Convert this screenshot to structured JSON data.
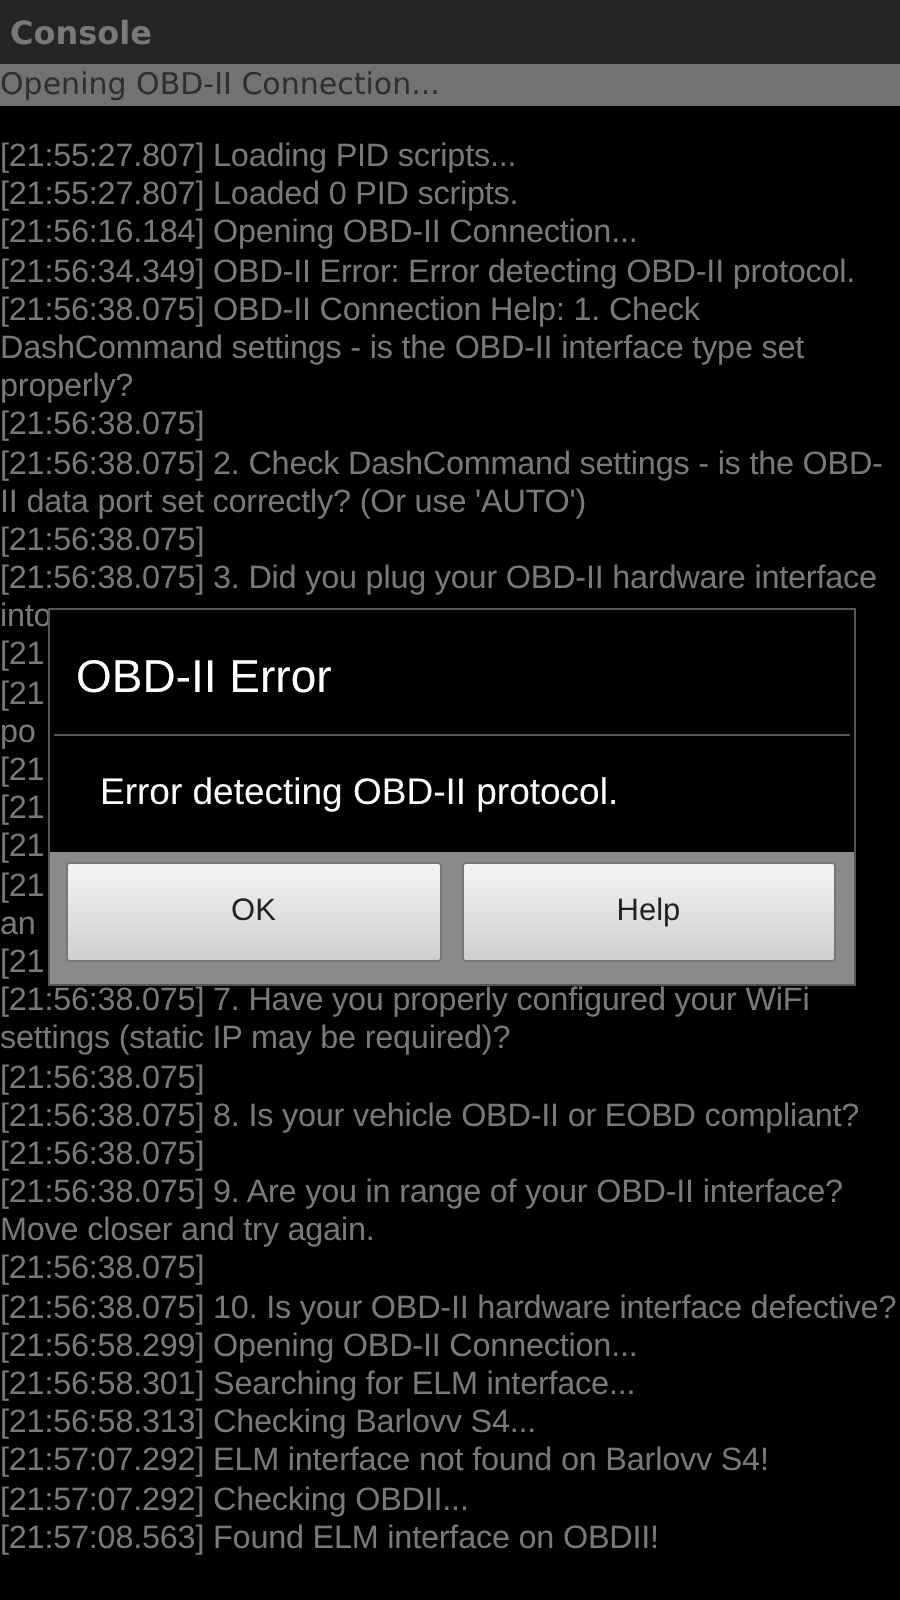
{
  "title_bar": {
    "title": "Console"
  },
  "status": {
    "text": "Opening OBD-II Connection..."
  },
  "log": [
    "[21:55:27.807] Loading PID scripts...",
    "[21:55:27.807] Loaded 0 PID scripts.",
    "[21:56:16.184] Opening OBD-II Connection...",
    "[21:56:34.349] OBD-II Error: Error detecting OBD-II protocol.",
    "[21:56:38.075] OBD-II Connection Help: 1. Check",
    "DashCommand settings - is the OBD-II interface type set",
    "properly?",
    "[21:56:38.075]",
    "[21:56:38.075] 2. Check DashCommand settings - is the OBD-",
    "II data port set correctly? (Or use 'AUTO')",
    "[21:56:38.075]",
    "[21:56:38.075] 3. Did you plug your OBD-II hardware interface",
    "into",
    "[21",
    "[21",
    "po",
    "[21",
    "[21",
    "[21",
    "[21",
    "an",
    "[21",
    "[21:56:38.075] 7. Have you properly configured your WiFi",
    "settings (static IP may be required)?",
    "[21:56:38.075]",
    "[21:56:38.075] 8. Is your vehicle OBD-II or EOBD compliant?",
    "[21:56:38.075]",
    "[21:56:38.075] 9. Are you in range of your OBD-II interface?",
    "Move closer and try again.",
    "[21:56:38.075]",
    "[21:56:38.075] 10. Is your OBD-II hardware interface defective?",
    "[21:56:58.299] Opening OBD-II Connection...",
    "[21:56:58.301] Searching for ELM interface...",
    "[21:56:58.313] Checking Barlovv S4...",
    "[21:57:07.292] ELM interface not found on Barlovv S4!",
    "[21:57:07.292] Checking OBDII...",
    "[21:57:08.563] Found ELM interface on OBDII!"
  ],
  "dialog": {
    "title": "OBD-II Error",
    "message": "Error detecting OBD-II protocol.",
    "buttons": [
      "OK",
      "Help"
    ]
  }
}
